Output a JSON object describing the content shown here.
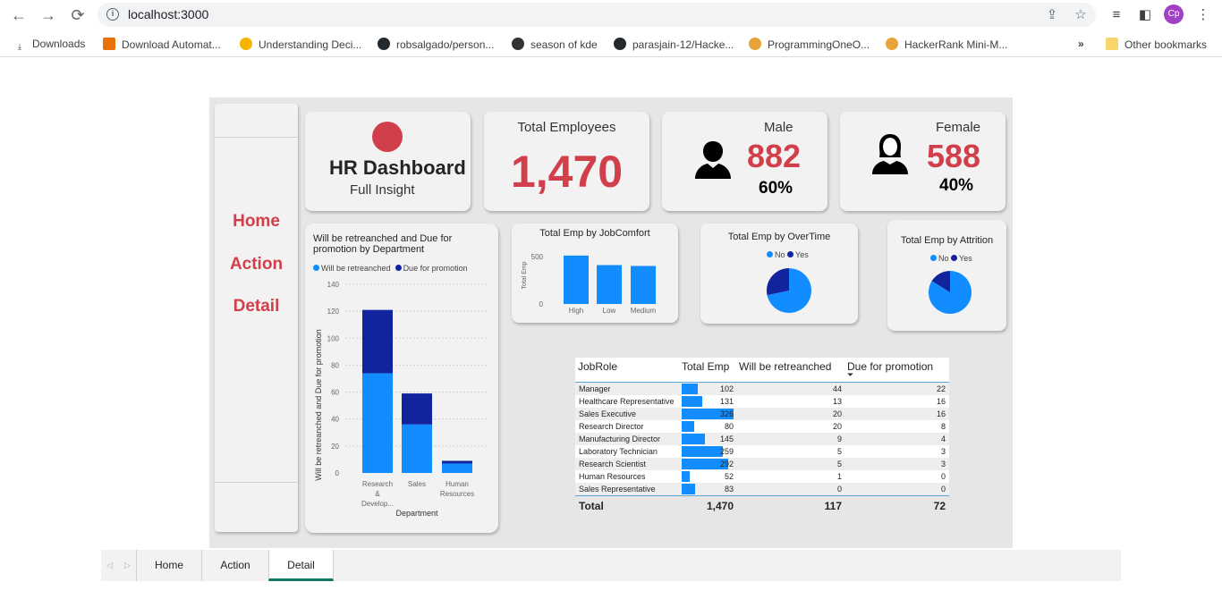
{
  "browser": {
    "url": "localhost:3000",
    "profile_initials": "Cp",
    "bookmarks": [
      {
        "label": "Downloads"
      },
      {
        "label": "Download Automat..."
      },
      {
        "label": "Understanding Deci..."
      },
      {
        "label": "robsalgado/person..."
      },
      {
        "label": "season of kde"
      },
      {
        "label": "parasjain-12/Hacke..."
      },
      {
        "label": "ProgrammingOneO..."
      },
      {
        "label": "HackerRank Mini-M..."
      }
    ],
    "more_label": "»",
    "other_bookmarks": "Other bookmarks"
  },
  "sidebar": {
    "links": [
      {
        "label": "Home"
      },
      {
        "label": "Action"
      },
      {
        "label": "Detail"
      }
    ]
  },
  "header": {
    "title": "HR Dashboard",
    "subtitle": "Full Insight",
    "accent_color": "#d13f4b"
  },
  "kpis": {
    "total": {
      "label": "Total Employees",
      "value": "1,470"
    },
    "male": {
      "label": "Male",
      "value": "882",
      "pct": "60%"
    },
    "female": {
      "label": "Female",
      "value": "588",
      "pct": "40%"
    }
  },
  "charts": {
    "dept": {
      "title_line1": "Will be retreanched and Due for",
      "title_line2": "promotion by Department",
      "legend_a": "Will be retreanched",
      "legend_b": "Due for promotion",
      "ylabel": "Will be retreanched and Due for promotion",
      "xlabel": "Department",
      "ticks": [
        "0",
        "20",
        "40",
        "60",
        "80",
        "100",
        "120",
        "140"
      ],
      "cat1_a": "Research",
      "cat1_b": "&",
      "cat1_c": "Develop...",
      "cat2": "Sales",
      "cat3_a": "Human",
      "cat3_b": "Resources"
    },
    "comfort": {
      "title": "Total Emp by JobComfort",
      "ylabel": "Total Emp",
      "tick_500": "500",
      "tick_0": "0",
      "cats": [
        "High",
        "Low",
        "Medium"
      ]
    },
    "overtime": {
      "title": "Total Emp by OverTime",
      "legend_no": "No",
      "legend_yes": "Yes"
    },
    "attrition": {
      "title": "Total Emp by Attrition",
      "legend_no": "No",
      "legend_yes": "Yes"
    }
  },
  "chart_data": [
    {
      "type": "bar",
      "title": "Will be retreanched and Due for promotion by Department",
      "stacked": true,
      "categories": [
        "Research & Develop...",
        "Sales",
        "Human Resources"
      ],
      "series": [
        {
          "name": "Will be retreanched",
          "values": [
            74,
            36,
            7
          ]
        },
        {
          "name": "Due for promotion",
          "values": [
            47,
            23,
            2
          ]
        }
      ],
      "xlabel": "Department",
      "ylabel": "Will be retreanched and Due for promotion",
      "ylim": [
        0,
        140
      ],
      "colors": [
        "#118dff",
        "#12239e"
      ],
      "legend": "top-left"
    },
    {
      "type": "bar",
      "title": "Total Emp by JobComfort",
      "categories": [
        "High",
        "Low",
        "Medium"
      ],
      "values": [
        560,
        450,
        440
      ],
      "ylabel": "Total Emp",
      "ylim": [
        0,
        600
      ],
      "colors": [
        "#118dff"
      ]
    },
    {
      "type": "pie",
      "title": "Total Emp by OverTime",
      "categories": [
        "No",
        "Yes"
      ],
      "values": [
        1054,
        416
      ],
      "colors": [
        "#118dff",
        "#12239e"
      ],
      "legend": "top"
    },
    {
      "type": "pie",
      "title": "Total Emp by Attrition",
      "categories": [
        "No",
        "Yes"
      ],
      "values": [
        1233,
        237
      ],
      "colors": [
        "#118dff",
        "#12239e"
      ],
      "legend": "top"
    }
  ],
  "table": {
    "headers": {
      "role": "JobRole",
      "total": "Total Emp",
      "retrench": "Will be retreanched",
      "promo": "Due for promotion"
    },
    "sort_indicator": "⏷",
    "rows": [
      {
        "role": "Manager",
        "total": "102",
        "total_n": 102,
        "retrench": "44",
        "promo": "22"
      },
      {
        "role": "Healthcare Representative",
        "total": "131",
        "total_n": 131,
        "retrench": "13",
        "promo": "16"
      },
      {
        "role": "Sales Executive",
        "total": "326",
        "total_n": 326,
        "retrench": "20",
        "promo": "16"
      },
      {
        "role": "Research Director",
        "total": "80",
        "total_n": 80,
        "retrench": "20",
        "promo": "8"
      },
      {
        "role": "Manufacturing Director",
        "total": "145",
        "total_n": 145,
        "retrench": "9",
        "promo": "4"
      },
      {
        "role": "Laboratory Technician",
        "total": "259",
        "total_n": 259,
        "retrench": "5",
        "promo": "3"
      },
      {
        "role": "Research Scientist",
        "total": "292",
        "total_n": 292,
        "retrench": "5",
        "promo": "3"
      },
      {
        "role": "Human Resources",
        "total": "52",
        "total_n": 52,
        "retrench": "1",
        "promo": "0"
      },
      {
        "role": "Sales Representative",
        "total": "83",
        "total_n": 83,
        "retrench": "0",
        "promo": "0"
      }
    ],
    "totals": {
      "label": "Total",
      "total": "1,470",
      "retrench": "117",
      "promo": "72"
    }
  },
  "pages": {
    "tabs": [
      {
        "label": "Home"
      },
      {
        "label": "Action"
      },
      {
        "label": "Detail"
      }
    ],
    "active": "Detail"
  }
}
